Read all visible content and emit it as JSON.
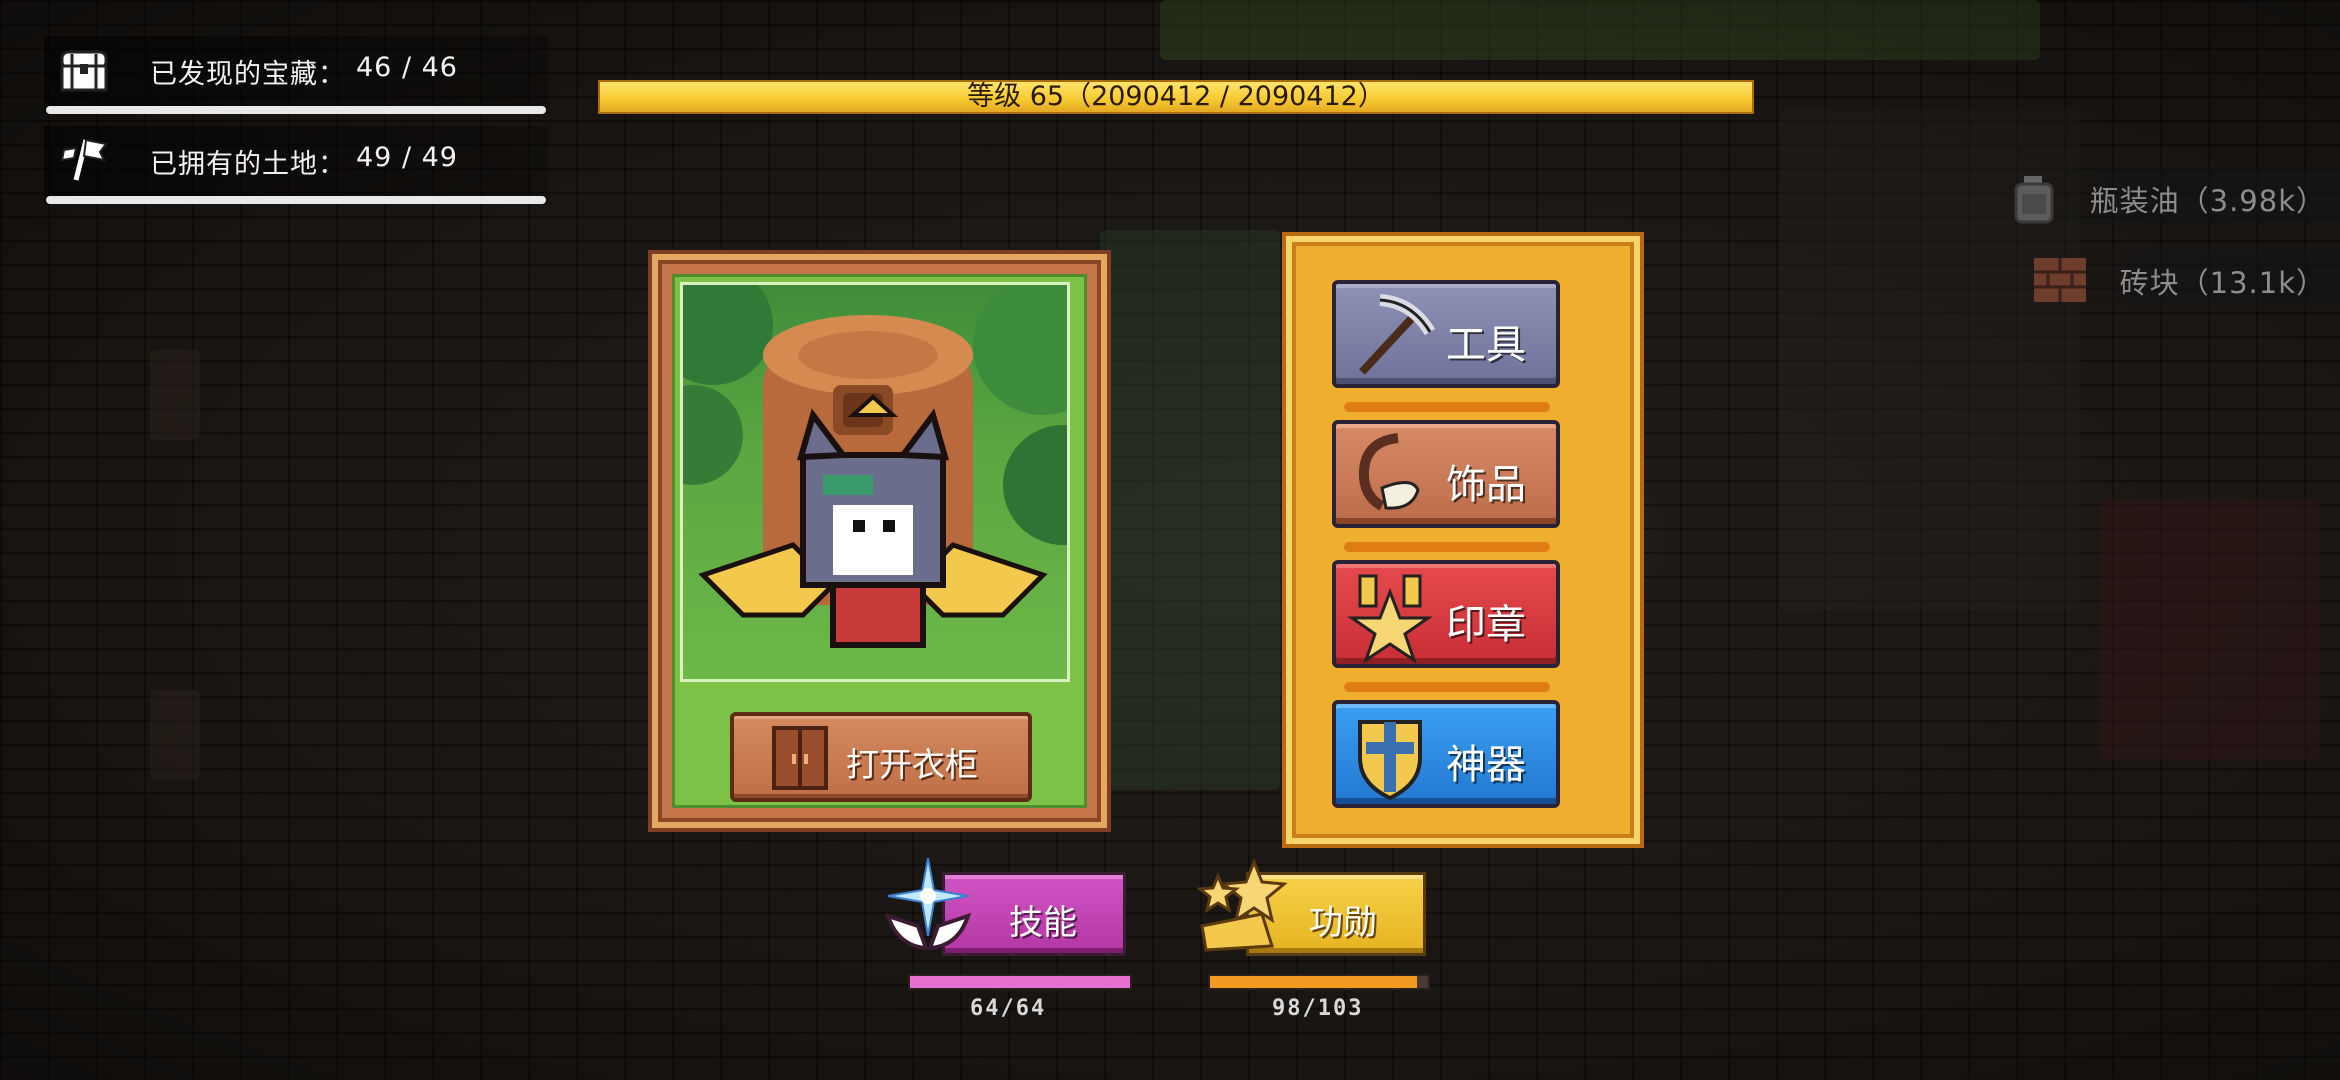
{
  "stats": {
    "treasure": {
      "label": "已发现的宝藏：",
      "value": "46 / 46",
      "icon": "treasure-chest-icon"
    },
    "land": {
      "label": "已拥有的土地：",
      "value": "49 / 49",
      "icon": "flag-icon"
    }
  },
  "level": {
    "text": "等级 65（2090412 / 2090412）",
    "progress": 1.0
  },
  "resources": [
    {
      "text": "瓶装油（3.98k）",
      "icon": "oil-bottle-icon"
    },
    {
      "text": "砖块（13.1k）",
      "icon": "brick-icon"
    }
  ],
  "character": {
    "wardrobe_label": "打开衣柜"
  },
  "equipment": {
    "tools": {
      "label": "工具",
      "icon": "pickaxe-icon",
      "color": "#7b7fa3"
    },
    "accessories": {
      "label": "饰品",
      "icon": "accessory-icon",
      "color": "#c46b4d"
    },
    "seals": {
      "label": "印章",
      "icon": "star-seal-icon",
      "color": "#d9393d"
    },
    "artifacts": {
      "label": "神器",
      "icon": "shield-icon",
      "color": "#2f8be3"
    }
  },
  "skills": {
    "label": "技能",
    "progress_text": "64/64",
    "progress": 1.0,
    "icon": "sparkle-hands-icon",
    "color": "#c43fb5"
  },
  "merit": {
    "label": "功勋",
    "progress_text": "98/103",
    "progress": 0.951,
    "icon": "stars-icon",
    "color": "#f0c02a"
  }
}
